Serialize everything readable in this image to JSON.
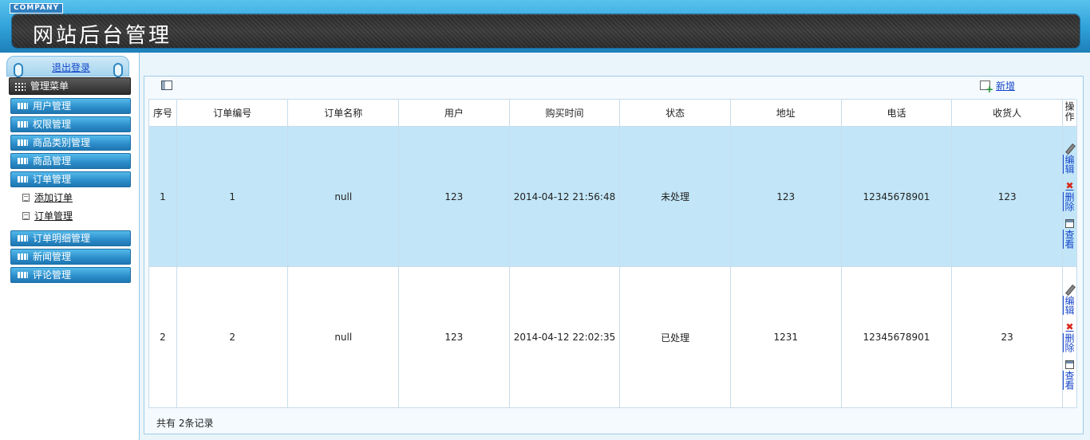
{
  "header": {
    "company": "COMPANY",
    "title": "网站后台管理"
  },
  "sidebar": {
    "logout": "退出登录",
    "menu_title": "管理菜单",
    "items": [
      {
        "label": "用户管理"
      },
      {
        "label": "权限管理"
      },
      {
        "label": "商品类别管理"
      },
      {
        "label": "商品管理"
      },
      {
        "label": "订单管理"
      },
      {
        "label": "订单明细管理"
      },
      {
        "label": "新闻管理"
      },
      {
        "label": "评论管理"
      }
    ],
    "order_sub_items": [
      {
        "label": "添加订单"
      },
      {
        "label": "订单管理"
      }
    ]
  },
  "toolbar": {
    "add_label": "新增"
  },
  "table": {
    "columns": [
      "序号",
      "订单编号",
      "订单名称",
      "用户",
      "购买时间",
      "状态",
      "地址",
      "电话",
      "收货人",
      "操作"
    ],
    "rows": [
      {
        "index": "1",
        "order_no": "1",
        "order_name": "null",
        "user": "123",
        "time": "2014-04-12 21:56:48",
        "status": "未处理",
        "address": "123",
        "phone": "12345678901",
        "receiver": "123"
      },
      {
        "index": "2",
        "order_no": "2",
        "order_name": "null",
        "user": "123",
        "time": "2014-04-12 22:02:35",
        "status": "已处理",
        "address": "1231",
        "phone": "12345678901",
        "receiver": "23"
      }
    ],
    "actions": {
      "edit": "编辑",
      "delete": "删除",
      "view": "查看"
    }
  },
  "footer": {
    "record_count": "共有 2条记录"
  }
}
